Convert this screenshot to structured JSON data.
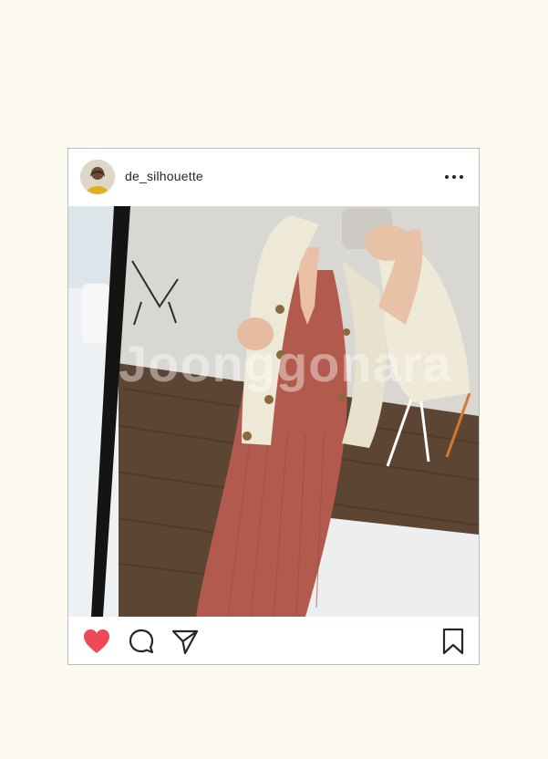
{
  "post": {
    "username": "de_silhouette",
    "watermark": "Joonggonara",
    "liked": true,
    "like_color": "#ed4956"
  },
  "icons": {
    "more": "more-horizontal-icon",
    "like": "heart-icon",
    "comment": "comment-icon",
    "share": "paper-plane-icon",
    "save": "bookmark-icon"
  }
}
